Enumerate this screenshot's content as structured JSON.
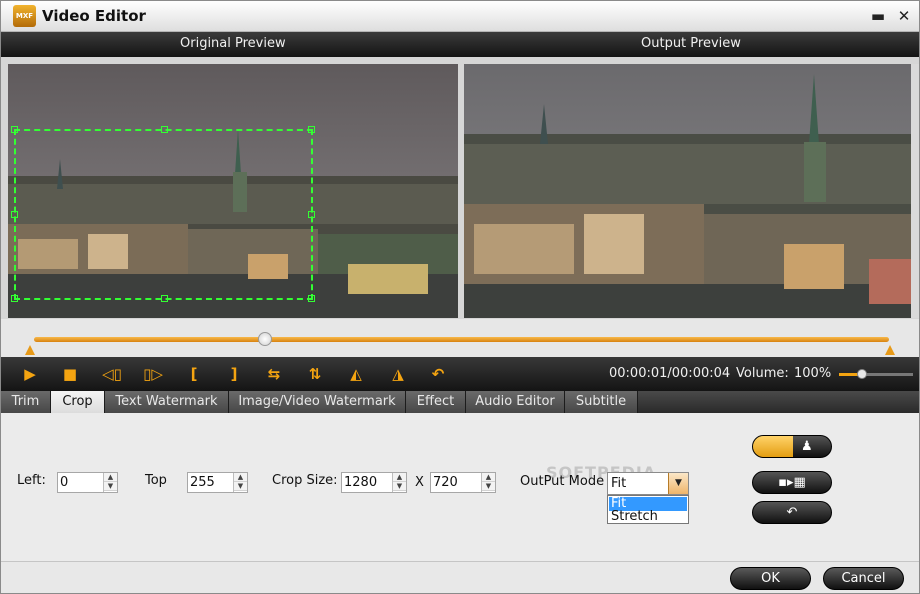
{
  "window": {
    "title": "Video Editor",
    "app_icon_text": "MXF",
    "minimize_glyph": "▬",
    "close_glyph": "✕"
  },
  "preview": {
    "original_label": "Original Preview",
    "output_label": "Output Preview"
  },
  "timeline": {
    "position_fraction": 0.27
  },
  "playback": {
    "time_display": "00:00:01/00:00:04",
    "volume_label": "Volume:",
    "volume_value": "100%",
    "volume_level": 1.0,
    "buttons": [
      {
        "name": "play-icon",
        "glyph": "▶"
      },
      {
        "name": "stop-icon",
        "glyph": "■"
      },
      {
        "name": "prev-frame-icon",
        "glyph": "◁▯"
      },
      {
        "name": "next-frame-icon",
        "glyph": "▯▷"
      },
      {
        "name": "mark-in-icon",
        "glyph": "["
      },
      {
        "name": "mark-out-icon",
        "glyph": "]"
      },
      {
        "name": "flip-horizontal-icon",
        "glyph": "⇆"
      },
      {
        "name": "flip-vertical-icon",
        "glyph": "⇅"
      },
      {
        "name": "rotate-left-icon",
        "glyph": "◭"
      },
      {
        "name": "rotate-right-icon",
        "glyph": "◮"
      },
      {
        "name": "undo-icon",
        "glyph": "↶"
      }
    ]
  },
  "tabs": [
    {
      "label": "Trim"
    },
    {
      "label": "Crop",
      "active": true
    },
    {
      "label": "Text Watermark"
    },
    {
      "label": "Image/Video Watermark"
    },
    {
      "label": "Effect"
    },
    {
      "label": "Audio Editor"
    },
    {
      "label": "Subtitle"
    }
  ],
  "crop": {
    "left_label": "Left:",
    "left_value": "0",
    "top_label": "Top",
    "top_value": "255",
    "size_label": "Crop Size:",
    "width_value": "1280",
    "x_label": "X",
    "height_value": "720",
    "output_mode_label": "OutPut Mode",
    "output_mode_value": "Fit",
    "output_mode_options": [
      "Fit",
      "Stretch"
    ],
    "watermark_text": "SOFTPEDIA"
  },
  "side_buttons": {
    "mode_toggle": "toggle-icon",
    "center_icon": "center-crop-icon",
    "reset_icon": "reset-icon"
  },
  "footer": {
    "ok_label": "OK",
    "cancel_label": "Cancel"
  },
  "colors": {
    "accent": "#f4a411",
    "crop_outline": "#33ff33"
  }
}
